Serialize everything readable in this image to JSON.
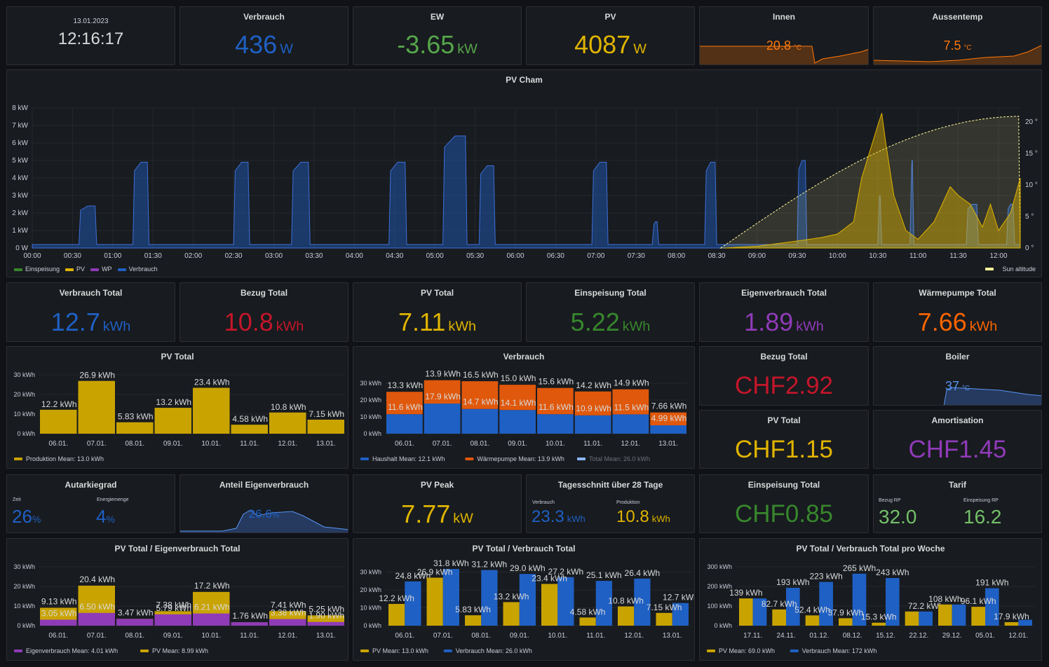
{
  "clock": {
    "date": "13.01.2023",
    "time": "12:16:17"
  },
  "top": [
    {
      "title": "Verbrauch",
      "value": "436",
      "unit": "W",
      "color": "#1f60c4"
    },
    {
      "title": "EW",
      "value": "-3.65",
      "unit": "kW",
      "color": "#56a64b"
    },
    {
      "title": "PV",
      "value": "4087",
      "unit": "W",
      "color": "#e0b400"
    }
  ],
  "innen": {
    "title": "Innen",
    "value": "20.8",
    "unit": "°C",
    "color": "#ff780a"
  },
  "aussen": {
    "title": "Aussentemp",
    "value": "7.5",
    "unit": "°C",
    "color": "#ff780a"
  },
  "pvcham": {
    "title": "PV Cham",
    "yticks": [
      "8 kW",
      "7 kW",
      "6 kW",
      "5 kW",
      "4 kW",
      "3 kW",
      "2 kW",
      "1 kW",
      "0 W"
    ],
    "y2ticks": [
      "20 °",
      "15 °",
      "10 °",
      "5 °",
      "0 °"
    ],
    "xticks": [
      "00:00",
      "00:30",
      "01:00",
      "01:30",
      "02:00",
      "02:30",
      "03:00",
      "03:30",
      "04:00",
      "04:30",
      "05:00",
      "05:30",
      "06:00",
      "06:30",
      "07:00",
      "07:30",
      "08:00",
      "08:30",
      "09:00",
      "09:30",
      "10:00",
      "10:30",
      "11:00",
      "11:30",
      "12:00"
    ],
    "legend": [
      "Einspeisung",
      "PV",
      "WP",
      "Verbrauch"
    ],
    "legend_colors": [
      "#37872d",
      "#e0b400",
      "#8f3bb8",
      "#1f60c4"
    ],
    "legend_right": "Sun altitude"
  },
  "totals": [
    {
      "title": "Verbrauch Total",
      "value": "12.7",
      "unit": "kWh",
      "color": "#1f60c4"
    },
    {
      "title": "Bezug Total",
      "value": "10.8",
      "unit": "kWh",
      "color": "#c4162a"
    },
    {
      "title": "PV Total",
      "value": "7.11",
      "unit": "kWh",
      "color": "#e0b400"
    },
    {
      "title": "Einspeisung Total",
      "value": "5.22",
      "unit": "kWh",
      "color": "#37872d"
    },
    {
      "title": "Eigenverbrauch Total",
      "value": "1.89",
      "unit": "kWh",
      "color": "#8f3bb8"
    },
    {
      "title": "Wärmepumpe Total",
      "value": "7.66",
      "unit": "kWh",
      "color": "#fa6400"
    }
  ],
  "chf": [
    {
      "title": "Bezug Total",
      "value": "CHF2.92",
      "color": "#c4162a"
    },
    {
      "title": "PV Total",
      "value": "CHF1.15",
      "color": "#e0b400"
    },
    {
      "title": "Amortisation",
      "value": "CHF1.45",
      "color": "#8f3bb8"
    },
    {
      "title": "Einspeisung Total",
      "value": "CHF0.85",
      "color": "#37872d"
    }
  ],
  "boiler": {
    "title": "Boiler",
    "value": "37",
    "unit": "°C",
    "color": "#5794f2"
  },
  "autarkie": {
    "title": "Autarkiegrad",
    "l1": "Zeit",
    "v1": "26",
    "l2": "Energiemenge",
    "v2": "4",
    "unit": "%"
  },
  "anteil": {
    "title": "Anteil Eigenverbrauch",
    "value": "26.6",
    "unit": "%"
  },
  "pvpeak": {
    "title": "PV Peak",
    "value": "7.77",
    "unit": "kW",
    "color": "#e0b400"
  },
  "tages": {
    "title": "Tagesschnitt über 28 Tage",
    "l1": "Verbrauch",
    "v1": "23.3",
    "l2": "Produktion",
    "v2": "10.8",
    "unit": "kWh"
  },
  "tarif": {
    "title": "Tarif",
    "l1": "Bezug RP",
    "v1": "32.0",
    "l2": "Einspeisung RP",
    "v2": "16.2"
  },
  "chart_data": [
    {
      "type": "bar",
      "title": "PV Total",
      "categories": [
        "06.01.",
        "07.01.",
        "08.01.",
        "09.01.",
        "10.01.",
        "11.01.",
        "12.01.",
        "13.01."
      ],
      "series": [
        {
          "name": "Produktion",
          "values": [
            12.2,
            26.9,
            5.83,
            13.2,
            23.4,
            4.58,
            10.8,
            7.15
          ],
          "labels": [
            "12.2 kWh",
            "26.9 kWh",
            "5.83 kWh",
            "13.2 kWh",
            "23.4 kWh",
            "4.58 kWh",
            "10.8 kWh",
            "7.15 kWh"
          ]
        }
      ],
      "yticks": [
        "30 kWh",
        "20 kWh",
        "10 kWh",
        "0 kWh"
      ],
      "ylim": [
        0,
        30
      ],
      "legend": [
        "Produktion  Mean: 13.0 kWh"
      ]
    },
    {
      "type": "bar",
      "title": "Verbrauch",
      "categories": [
        "06.01.",
        "07.01.",
        "08.01.",
        "09.01.",
        "10.01.",
        "11.01.",
        "12.01.",
        "13.01."
      ],
      "stacked": true,
      "series": [
        {
          "name": "Haushalt",
          "values": [
            11.6,
            17.9,
            14.7,
            14.1,
            11.6,
            10.9,
            11.5,
            4.99
          ]
        },
        {
          "name": "Wärmepumpe",
          "values": [
            13.3,
            13.9,
            16.5,
            15.0,
            15.6,
            14.2,
            14.9,
            7.66
          ]
        }
      ],
      "labels_bottom": [
        "11.6 kWh",
        "17.9 kWh",
        "14.7 kWh",
        "14.1 kWh",
        "11.6 kWh",
        "10.9 kWh",
        "11.5 kWh",
        "4.99 kWh"
      ],
      "labels_top": [
        "13.3 kWh",
        "13.9 kWh",
        "16.5 kWh",
        "15.0 kWh",
        "15.6 kWh",
        "14.2 kWh",
        "14.9 kWh",
        "7.66 kWh"
      ],
      "yticks": [
        "30 kWh",
        "20 kWh",
        "10 kWh",
        "0 kWh"
      ],
      "ylim": [
        0,
        30
      ],
      "legend": [
        "Haushalt  Mean: 12.1 kWh",
        "Wärmepumpe  Mean: 13.9 kWh",
        "Total  Mean: 26.0 kWh"
      ]
    },
    {
      "type": "bar",
      "title": "PV Total / Eigenverbrauch Total",
      "categories": [
        "06.01.",
        "07.01.",
        "08.01.",
        "09.01.",
        "10.01.",
        "11.01.",
        "12.01.",
        "13.01."
      ],
      "series": [
        {
          "name": "Eigenverbrauch",
          "values": [
            3.05,
            6.5,
            3.47,
            5.79,
            6.21,
            1.76,
            3.38,
            1.9
          ]
        },
        {
          "name": "PV",
          "values": [
            9.13,
            20.4,
            3.47,
            7.38,
            17.2,
            1.76,
            7.41,
            5.25
          ]
        }
      ],
      "labels_bottom": [
        "3.05 kWh",
        "6.50 kWh",
        "3.47 kWh",
        "5.79 kWh",
        "6.21 kWh",
        "1.76 kWh",
        "3.38 kWh",
        "1.90 kWh"
      ],
      "labels_top": [
        "9.13 kWh",
        "20.4 kWh",
        "",
        "7.38 kWh",
        "17.2 kWh",
        "",
        "7.41 kWh",
        "5.25 kWh"
      ],
      "yticks": [
        "30 kWh",
        "20 kWh",
        "10 kWh",
        "0 kWh"
      ],
      "ylim": [
        0,
        30
      ],
      "legend": [
        "Eigenverbrauch  Mean: 4.01 kWh",
        "PV  Mean: 8.99 kWh"
      ]
    },
    {
      "type": "bar",
      "title": "PV Total / Verbrauch Total",
      "categories": [
        "06.01.",
        "07.01.",
        "08.01.",
        "09.01.",
        "10.01.",
        "11.01.",
        "12.01.",
        "13.01."
      ],
      "series": [
        {
          "name": "PV",
          "values": [
            12.2,
            26.9,
            5.83,
            13.2,
            23.4,
            4.58,
            10.8,
            7.15
          ],
          "labels": [
            "12.2 kWh",
            "26.9 kWh",
            "5.83 kWh",
            "13.2 kWh",
            "23.4 kWh",
            "4.58 kWh",
            "10.8 kWh",
            "7.15 kWh"
          ]
        },
        {
          "name": "Verbrauch",
          "values": [
            24.8,
            31.8,
            31.2,
            29.0,
            27.2,
            25.1,
            26.4,
            12.7
          ],
          "labels": [
            "24.8 kWh",
            "31.8 kWh",
            "31.2 kWh",
            "29.0 kWh",
            "27.2 kWh",
            "25.1 kWh",
            "26.4 kWh",
            "12.7 kWh"
          ]
        }
      ],
      "yticks": [
        "30 kWh",
        "20 kWh",
        "10 kWh",
        "0 kWh"
      ],
      "ylim": [
        0,
        33
      ],
      "legend": [
        "PV  Mean: 13.0 kWh",
        "Verbrauch  Mean: 26.0 kWh"
      ]
    },
    {
      "type": "bar",
      "title": "PV Total / Verbrauch Total pro Woche",
      "categories": [
        "17.11.",
        "24.11.",
        "01.12.",
        "08.12.",
        "15.12.",
        "22.12.",
        "29.12.",
        "05.01.",
        "12.01."
      ],
      "series": [
        {
          "name": "PV",
          "values": [
            139,
            82.7,
            52.4,
            37.9,
            15.3,
            72.2,
            108,
            96.1,
            17.9
          ],
          "labels": [
            "139 kWh",
            "82.7 kWh",
            "52.4 kWh",
            "37.9 kWh",
            "15.3 kWh",
            "",
            "108 kWh",
            "96.1 kWh",
            "17.9 kWh"
          ]
        },
        {
          "name": "Verbrauch",
          "values": [
            139,
            193,
            223,
            265,
            243,
            72.2,
            108,
            191,
            30
          ],
          "labels": [
            "",
            "193 kWh",
            "223 kWh",
            "265 kWh",
            "243 kWh",
            "72.2 kWh",
            "",
            "191 kWh",
            ""
          ]
        }
      ],
      "yticks": [
        "300 kWh",
        "200 kWh",
        "100 kWh",
        "0 kWh"
      ],
      "ylim": [
        0,
        300
      ],
      "legend": [
        "PV  Mean: 69.0 kWh",
        "Verbrauch  Mean: 172 kWh"
      ]
    }
  ]
}
